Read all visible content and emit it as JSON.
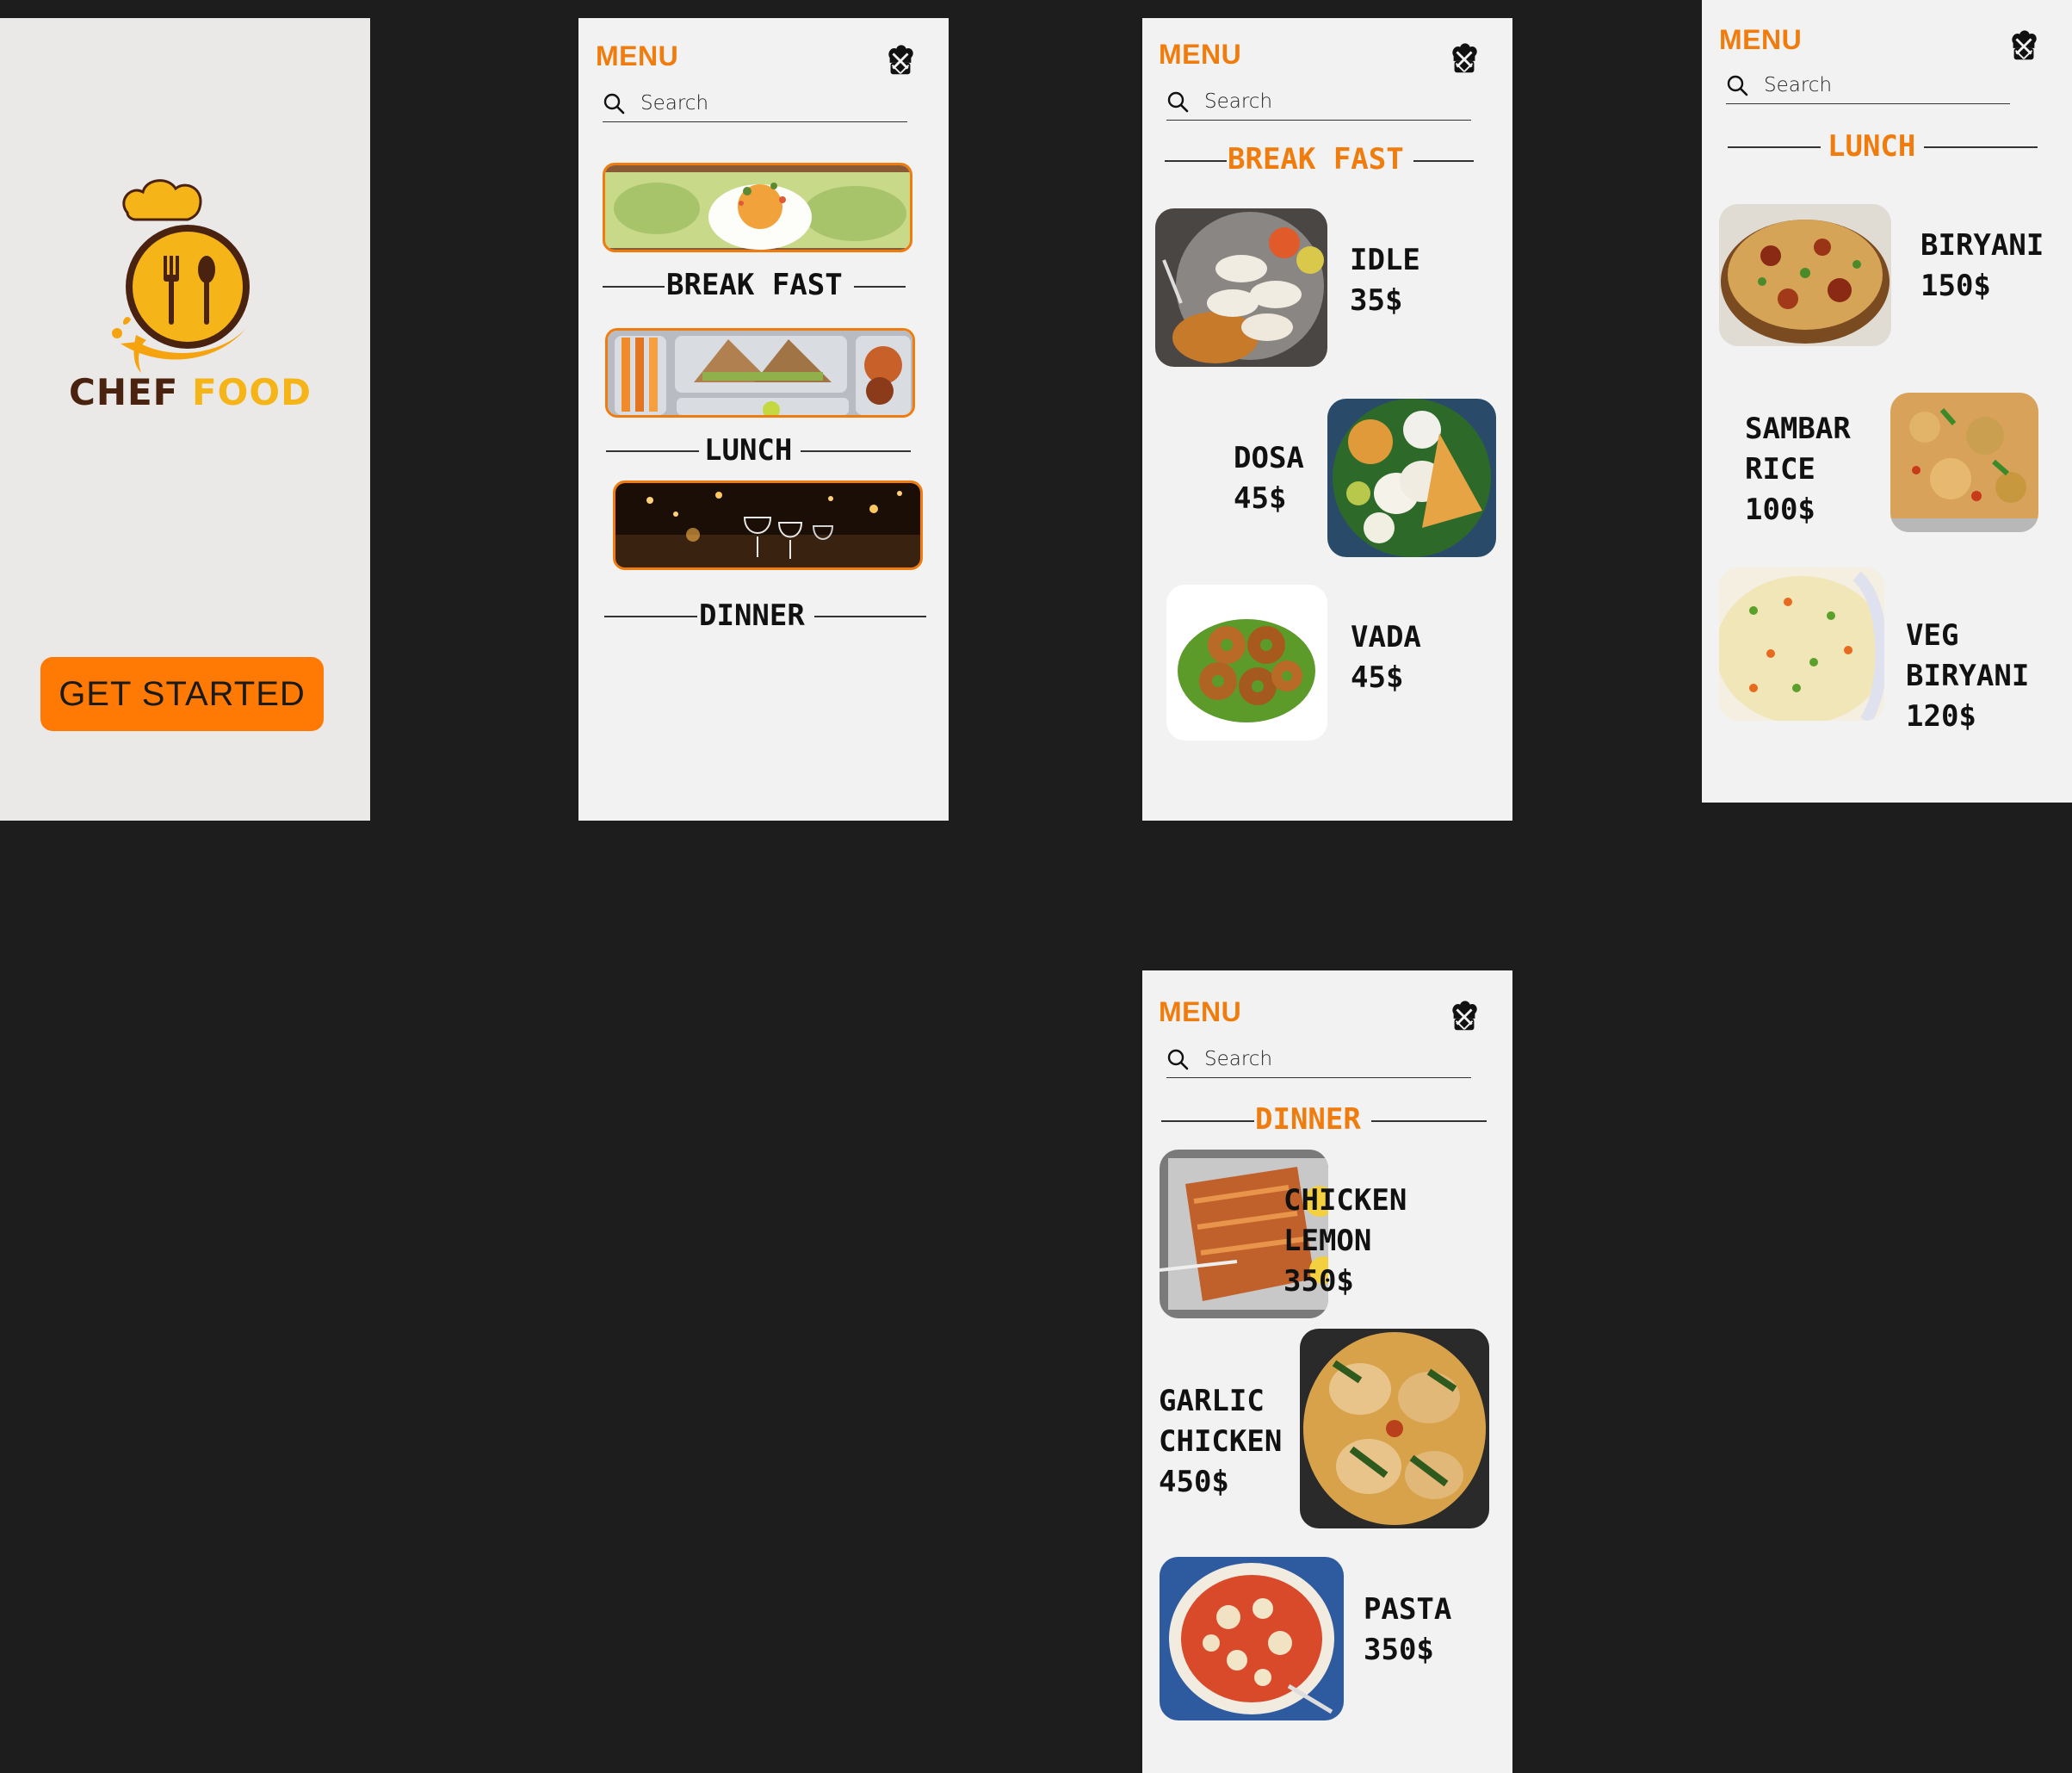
{
  "colors": {
    "accent": "#f07c0e",
    "button": "#ff7a05",
    "logo_dark": "#4a2310",
    "logo_gold": "#f5b417",
    "background": "#1d1d1d",
    "screen": "#f2f2f2"
  },
  "splash": {
    "logo_word1": "CHEF",
    "logo_word2": "FOOD",
    "button_label": "GET STARTED"
  },
  "header": {
    "menu_title": "MENU",
    "search_placeholder": "Search",
    "profile_icon": "chef-hat-icon"
  },
  "menu_screen": {
    "sections": [
      {
        "label": "BREAK FAST"
      },
      {
        "label": "LUNCH"
      },
      {
        "label": "DINNER"
      }
    ]
  },
  "breakfast_screen": {
    "title": "BREAK FAST",
    "items": [
      {
        "name": "IDLE",
        "price": "35$"
      },
      {
        "name": "DOSA",
        "price": "45$"
      },
      {
        "name": "VADA",
        "price": "45$"
      }
    ]
  },
  "lunch_screen": {
    "title": "LUNCH",
    "items": [
      {
        "name_line1": "BIRYANI",
        "price": "150$"
      },
      {
        "name_line1": "SAMBAR",
        "name_line2": "RICE",
        "price": "100$"
      },
      {
        "name_line1": "VEG",
        "name_line2": "BIRYANI",
        "price": "120$"
      }
    ]
  },
  "dinner_screen": {
    "title": "DINNER",
    "items": [
      {
        "name_line1": "CHICKEN",
        "name_line2": "LEMON",
        "price": "350$"
      },
      {
        "name_line1": "GARLIC",
        "name_line2": "CHICKEN",
        "price": "450$"
      },
      {
        "name_line1": "PASTA",
        "price": "350$"
      }
    ]
  }
}
